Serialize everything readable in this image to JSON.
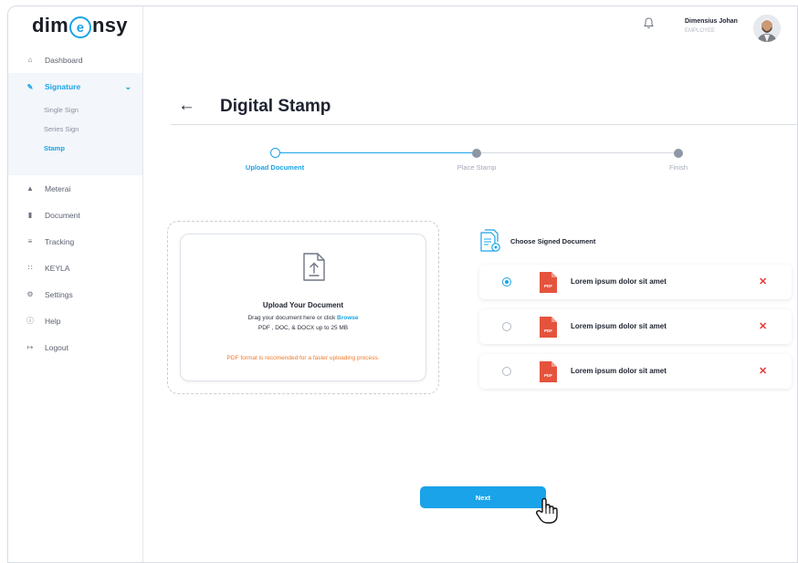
{
  "brand": {
    "logo_pre": "dim",
    "logo_mid": "e",
    "logo_post": "nsy"
  },
  "sidebar": {
    "items": [
      {
        "label": "Dashboard",
        "icon": "home-icon"
      },
      {
        "label": "Signature",
        "icon": "signature-icon"
      },
      {
        "label": "Meterai",
        "icon": "stamp-icon"
      },
      {
        "label": "Document",
        "icon": "document-icon"
      },
      {
        "label": "Tracking",
        "icon": "tracking-icon"
      },
      {
        "label": "KEYLA",
        "icon": "grid-icon"
      },
      {
        "label": "Settings",
        "icon": "gear-icon"
      },
      {
        "label": "Help",
        "icon": "help-icon"
      },
      {
        "label": "Logout",
        "icon": "logout-icon"
      }
    ],
    "signature_sub": [
      "Single Sign",
      "Series Sign",
      "Stamp"
    ]
  },
  "user": {
    "name": "Dimensius Johan",
    "role": "EMPLOYEE"
  },
  "page": {
    "title": "Digital Stamp"
  },
  "steps": [
    {
      "label": "Upload Document",
      "state": "active"
    },
    {
      "label": "Place Stamp",
      "state": "todo"
    },
    {
      "label": "Finish",
      "state": "todo"
    }
  ],
  "upload": {
    "title": "Upload Your Document",
    "drag_text": "Drag your document here or click ",
    "browse": "Browse",
    "formats": "PDF , DOC, & DOCX up to 25 MB",
    "note": "PDF format is recomended for a faster uploading process."
  },
  "signed": {
    "title": "Choose Signed Document",
    "docs": [
      {
        "name": "Lorem ipsum dolor sit amet",
        "type": "PDF",
        "selected": true
      },
      {
        "name": "Lorem ipsum dolor sit amet",
        "type": "PDF",
        "selected": false
      },
      {
        "name": "Lorem ipsum dolor sit amet",
        "type": "PDF",
        "selected": false
      }
    ]
  },
  "actions": {
    "next": "Next"
  },
  "colors": {
    "accent": "#1aa3e8",
    "warning": "#f0782a",
    "danger": "#e53935",
    "pdf": "#e5533d"
  }
}
